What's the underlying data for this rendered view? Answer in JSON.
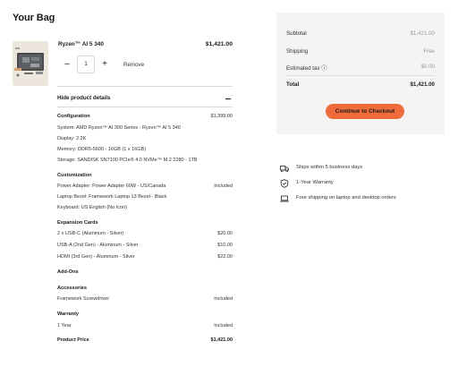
{
  "page": {
    "title": "Your Bag"
  },
  "product": {
    "name": "Ryzen™ AI 5 340",
    "price": "$1,421.00",
    "quantity": "1",
    "remove_label": "Remove",
    "image_icon": "laptop-product-image"
  },
  "details": {
    "toggle_label": "Hide product details",
    "configuration": {
      "heading": "Configuration",
      "price": "$1,399.00",
      "lines": [
        "System: AMD Ryzen™ AI 300 Series - Ryzen™ AI 5 340",
        "Display: 2.2K",
        "Memory: DDR5-5600 - 16GB (1 x 16GB)",
        "Storage: SANDISK SN7100 PCIe® 4.0 NVMe™ M.2 2280 - 1TB"
      ]
    },
    "customization": {
      "heading": "Customization",
      "lines": [
        {
          "label": "Power Adapter: Power Adapter 60W - US/Canada",
          "value": "Included"
        },
        {
          "label": "Laptop Bezel: Framework Laptop 13 Bezel - Black",
          "value": ""
        },
        {
          "label": "Keyboard: US English (No Icon)",
          "value": ""
        }
      ]
    },
    "expansion": {
      "heading": "Expansion Cards",
      "lines": [
        {
          "label": "2 x USB-C (Aluminum - Silver)",
          "value": "$20.00"
        },
        {
          "label": "USB-A (2nd Gen) - Aluminum - Silver",
          "value": "$10.00"
        },
        {
          "label": "HDMI (3rd Gen) - Aluminum - Silver",
          "value": "$22.00"
        }
      ]
    },
    "addons": {
      "heading": "Add-Ons"
    },
    "accessories": {
      "heading": "Accessories",
      "lines": [
        {
          "label": "Framework Screwdriver",
          "value": "Included"
        }
      ]
    },
    "warranty": {
      "heading": "Warranty",
      "lines": [
        {
          "label": "1 Year",
          "value": "Included"
        }
      ]
    },
    "product_price": {
      "label": "Product Price",
      "value": "$1,421.00"
    }
  },
  "summary": {
    "subtotal_label": "Subtotal",
    "subtotal_value": "$1,421.00",
    "shipping_label": "Shipping",
    "shipping_value": "Free",
    "tax_label": "Estimated tax ⓘ",
    "tax_value": "$0.00",
    "total_label": "Total",
    "total_value": "$1,421.00",
    "checkout_label": "Continue to Checkout",
    "accent_color": "#f06b3a"
  },
  "features": [
    {
      "icon": "truck-icon",
      "text": "Ships within 5 business days"
    },
    {
      "icon": "shield-check-icon",
      "text": "1-Year Warranty"
    },
    {
      "icon": "laptop-icon",
      "text": "Free shipping on laptop and desktop orders"
    }
  ]
}
